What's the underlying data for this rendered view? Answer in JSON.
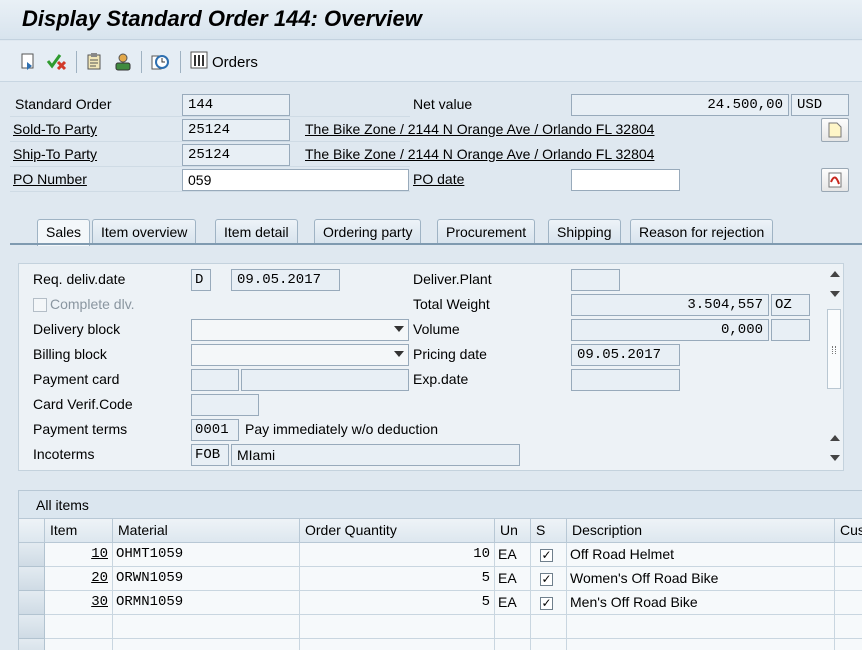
{
  "window": {
    "title": "Display Standard Order 144: Overview"
  },
  "toolbar": {
    "icons": [
      "display-change-icon",
      "check-cancel-icon",
      "document-icon",
      "person-icon",
      "clock-icon",
      "orders-list-icon"
    ],
    "orders_label": "Orders"
  },
  "header": {
    "standard_order_label": "Standard Order",
    "standard_order_value": "144",
    "net_value_label": "Net value",
    "net_value": "24.500,00",
    "currency": "USD",
    "sold_to_label": "Sold-To Party",
    "sold_to_value": "25124",
    "sold_to_address": "The Bike Zone / 2144 N Orange Ave / Orlando FL 32804",
    "ship_to_label": "Ship-To Party",
    "ship_to_value": "25124",
    "ship_to_address": "The Bike Zone / 2144 N Orange Ave / Orlando FL 32804",
    "po_number_label": "PO Number",
    "po_number_value": "059",
    "po_date_label": "PO date",
    "po_date_value": ""
  },
  "tabs": [
    {
      "label": "Sales",
      "active": true
    },
    {
      "label": "Item overview",
      "active": false
    },
    {
      "label": "Item detail",
      "active": false
    },
    {
      "label": "Ordering party",
      "active": false
    },
    {
      "label": "Procurement",
      "active": false
    },
    {
      "label": "Shipping",
      "active": false
    },
    {
      "label": "Reason for rejection",
      "active": false
    }
  ],
  "sales": {
    "req_deliv_date_label": "Req. deliv.date",
    "req_deliv_date_unit": "D",
    "req_deliv_date": "09.05.2017",
    "complete_dlv_label": "Complete dlv.",
    "delivery_block_label": "Delivery block",
    "delivery_block_value": "",
    "billing_block_label": "Billing block",
    "billing_block_value": "",
    "payment_card_label": "Payment card",
    "card_verif_label": "Card Verif.Code",
    "payment_terms_label": "Payment terms",
    "payment_terms_code": "0001",
    "payment_terms_text": "Pay immediately w/o deduction",
    "incoterms_label": "Incoterms",
    "incoterms_code": "FOB",
    "incoterms_text": "MIami",
    "deliver_plant_label": "Deliver.Plant",
    "deliver_plant_value": "",
    "total_weight_label": "Total Weight",
    "total_weight_value": "3.504,557",
    "total_weight_unit": "OZ",
    "volume_label": "Volume",
    "volume_value": "0,000",
    "volume_unit": "",
    "pricing_date_label": "Pricing date",
    "pricing_date_value": "09.05.2017",
    "exp_date_label": "Exp.date",
    "exp_date_value": ""
  },
  "items": {
    "title": "All items",
    "columns": [
      "Item",
      "Material",
      "Order Quantity",
      "Un",
      "S",
      "Description",
      "Cust"
    ],
    "rows": [
      {
        "item": "10",
        "material": "OHMT1059",
        "qty": "10",
        "un": "EA",
        "s": true,
        "description": "Off Road Helmet"
      },
      {
        "item": "20",
        "material": "ORWN1059",
        "qty": "5",
        "un": "EA",
        "s": true,
        "description": "Women's Off Road Bike"
      },
      {
        "item": "30",
        "material": "ORMN1059",
        "qty": "5",
        "un": "EA",
        "s": true,
        "description": "Men's Off Road Bike"
      }
    ]
  },
  "colors": {
    "accent": "#7f9ab0",
    "background": "#dfe8f0"
  }
}
